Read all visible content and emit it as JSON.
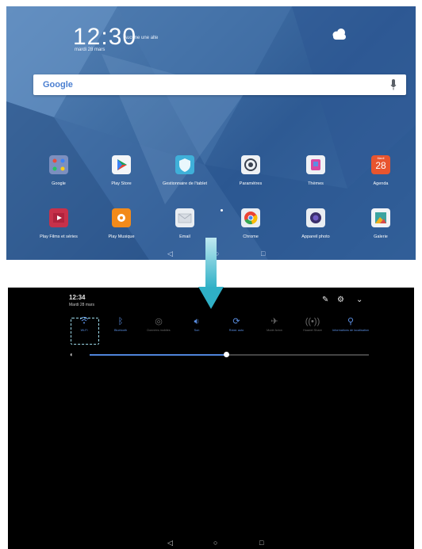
{
  "home": {
    "clock_time": "12:30",
    "clock_subtitle": "Aucune une alte",
    "clock_date": "mardi 28 mars",
    "search_logo": "Google",
    "apps_row1": [
      {
        "label": "Google",
        "icon": "google-folder-icon",
        "color": "#7c8fbf"
      },
      {
        "label": "Play Store",
        "icon": "play-store-icon",
        "color": "#f3f5f8"
      },
      {
        "label": "Gestionnaire de l'tablet",
        "icon": "shield-icon",
        "color": "#3fb0d9"
      },
      {
        "label": "Paramètres",
        "icon": "settings-icon",
        "color": "#eef1f5"
      },
      {
        "label": "Thèmes",
        "icon": "themes-icon",
        "color": "#eef1f5"
      },
      {
        "label": "Agenda",
        "icon": "calendar-icon",
        "color": "#e8552f"
      }
    ],
    "apps_row2": [
      {
        "label": "Play Films et séries",
        "icon": "play-movies-icon",
        "color": "#c7314a"
      },
      {
        "label": "Play Musique",
        "icon": "play-music-icon",
        "color": "#f28a1a"
      },
      {
        "label": "Email",
        "icon": "email-icon",
        "color": "#e9edf2"
      },
      {
        "label": "Chrome",
        "icon": "chrome-icon",
        "color": "#e9edf2"
      },
      {
        "label": "Appareil photo",
        "icon": "camera-icon",
        "color": "#e9edf2"
      },
      {
        "label": "Galerie",
        "icon": "gallery-icon",
        "color": "#f1f3f6"
      }
    ],
    "calendar_day": "28",
    "calendar_weekday": "Mardi"
  },
  "panel": {
    "time": "12:34",
    "date": "Mardi 28 mars",
    "tiles": [
      {
        "label": "Wi-Fi",
        "icon": "wifi-icon",
        "active": true
      },
      {
        "label": "Bluetooth",
        "icon": "bluetooth-icon",
        "active": true
      },
      {
        "label": "Données mobiles",
        "icon": "mobile-data-icon",
        "active": false
      },
      {
        "label": "Son",
        "icon": "sound-icon",
        "active": true
      },
      {
        "label": "Rotat. auto",
        "icon": "auto-rotate-icon",
        "active": true
      },
      {
        "label": "Mode Avion",
        "icon": "airplane-icon",
        "active": false
      },
      {
        "label": "Huawei Share",
        "icon": "share-icon",
        "active": false
      },
      {
        "label": "Informations de localisation",
        "icon": "location-icon",
        "active": true
      }
    ],
    "brightness_level": 0.49
  },
  "colors": {
    "accent": "#5b8fe3",
    "highlight": "#9fdcec",
    "arrow": "#35b3c8"
  }
}
